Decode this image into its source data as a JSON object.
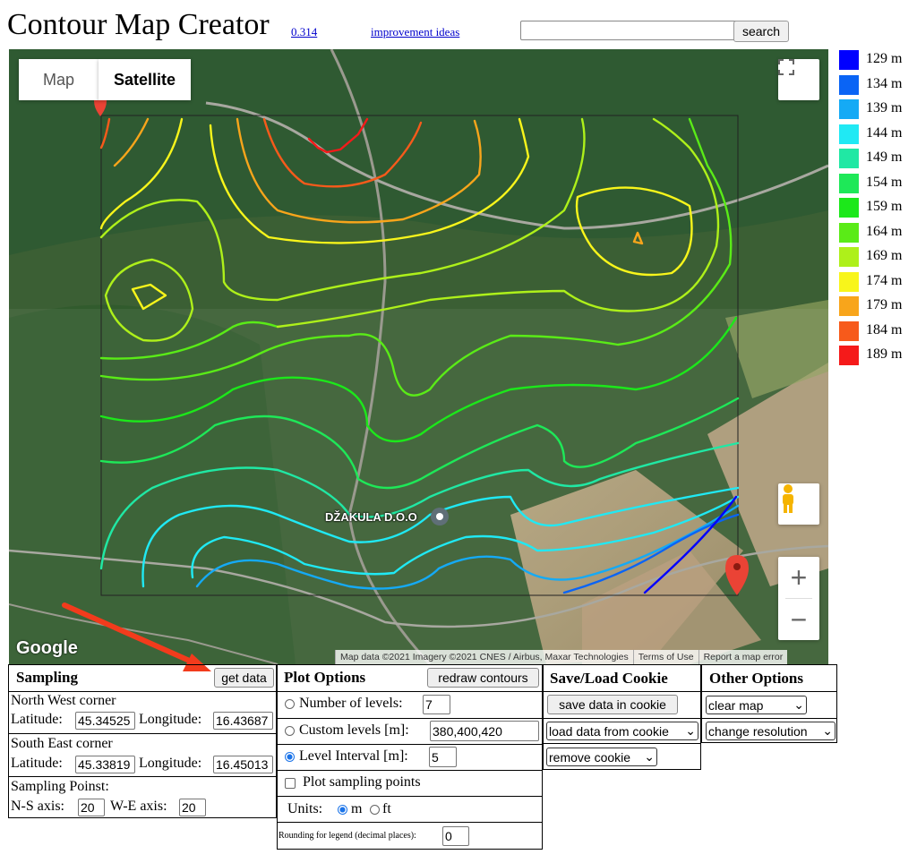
{
  "header": {
    "title": "Contour Map Creator",
    "version_link": "0.314",
    "ideas_link": "improvement ideas",
    "search_placeholder": "",
    "search_label": "search"
  },
  "map": {
    "type_map_label": "Map",
    "type_satellite_label": "Satellite",
    "place_label": "DŽAKULA D.O.O",
    "google_logo": "Google",
    "attribution": {
      "data": "Map data ©2021 Imagery ©2021 CNES / Airbus, Maxar Technologies",
      "terms": "Terms of Use",
      "report": "Report a map error"
    },
    "zoom_in": "+",
    "zoom_out": "−",
    "fullscreen_icon": "fullscreen-icon",
    "pegman_icon": "pegman-icon"
  },
  "legend": [
    {
      "label": "129 m",
      "color": "#0000ff"
    },
    {
      "label": "134 m",
      "color": "#0a64f5"
    },
    {
      "label": "139 m",
      "color": "#15aaf5"
    },
    {
      "label": "144 m",
      "color": "#20e9f4"
    },
    {
      "label": "149 m",
      "color": "#20e8a4"
    },
    {
      "label": "154 m",
      "color": "#1ee858"
    },
    {
      "label": "159 m",
      "color": "#1ce81a"
    },
    {
      "label": "164 m",
      "color": "#5aeb17"
    },
    {
      "label": "169 m",
      "color": "#aef01a"
    },
    {
      "label": "174 m",
      "color": "#f8f51b"
    },
    {
      "label": "179 m",
      "color": "#f8a51b"
    },
    {
      "label": "184 m",
      "color": "#f75a1b"
    },
    {
      "label": "189 m",
      "color": "#f51a1a"
    }
  ],
  "sampling": {
    "title": "Sampling",
    "get_data": "get data",
    "nw_label": "North West corner",
    "lat_label": "Latitude:",
    "lon_label": "Longitude:",
    "nw_lat": "45.34525",
    "nw_lon": "16.43687",
    "se_label": "South East corner",
    "se_lat": "45.33819",
    "se_lon": "16.45013",
    "points_label": "Sampling Poinst:",
    "ns_label": "N-S axis:",
    "ns_value": "20",
    "we_label": "W-E axis:",
    "we_value": "20"
  },
  "plot": {
    "title": "Plot Options",
    "redraw": "redraw contours",
    "num_levels_label": "Number of levels:",
    "num_levels_value": "7",
    "custom_levels_label": "Custom levels [m]:",
    "custom_levels_value": "380,400,420",
    "interval_label": "Level Interval [m]:",
    "interval_value": "5",
    "plot_points_label": "Plot sampling points",
    "units_label": "Units:",
    "unit_m": "m",
    "unit_ft": "ft",
    "rounding_label": "Rounding for legend (decimal places):",
    "rounding_value": "0"
  },
  "cookie": {
    "title": "Save/Load Cookie",
    "save": "save data in cookie",
    "load": "load data from cookie",
    "remove": "remove cookie"
  },
  "other": {
    "title": "Other Options",
    "clear": "clear map",
    "resolution": "change resolution"
  }
}
